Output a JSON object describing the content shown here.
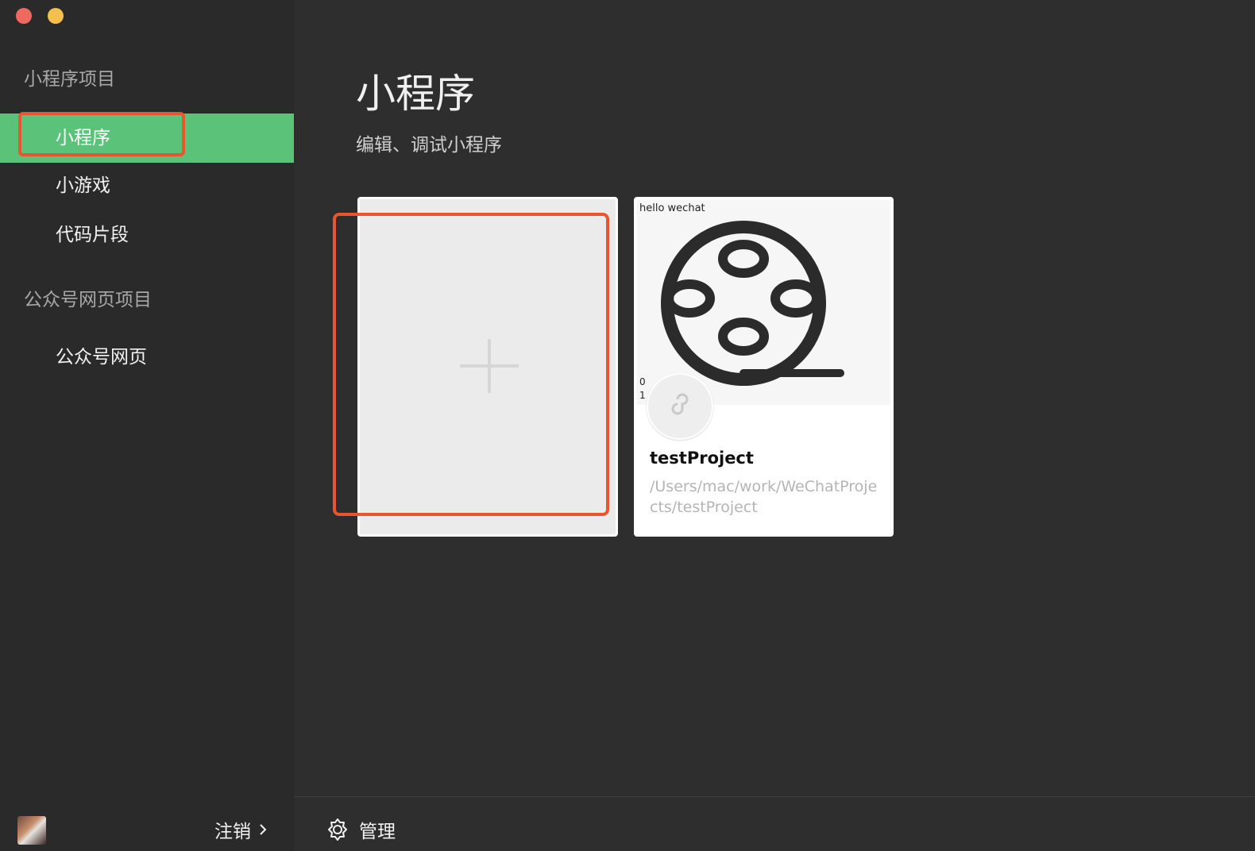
{
  "sidebar": {
    "sections": [
      {
        "title": "小程序项目",
        "items": [
          "小程序",
          "小游戏",
          "代码片段"
        ]
      },
      {
        "title": "公众号网页项目",
        "items": [
          "公众号网页"
        ]
      }
    ],
    "active_item": "小程序",
    "footer": {
      "logout_label": "注销"
    }
  },
  "main": {
    "title": "小程序",
    "subtitle": "编辑、调试小程序",
    "cards": [
      {
        "type": "new",
        "icon": "plus-icon"
      },
      {
        "type": "project",
        "preview_text": "hello wechat",
        "preview_small_1": "0",
        "preview_small_2": "1",
        "name": "testProject",
        "path": "/Users/mac/work/WeChatProjects/testProject"
      }
    ]
  },
  "bottom_bar": {
    "manage_label": "管理"
  },
  "colors": {
    "sidebar_bg": "#2a2a2a",
    "main_bg": "#2e2e2e",
    "active_green": "#5bc27a",
    "highlight_red": "#e9552f"
  }
}
